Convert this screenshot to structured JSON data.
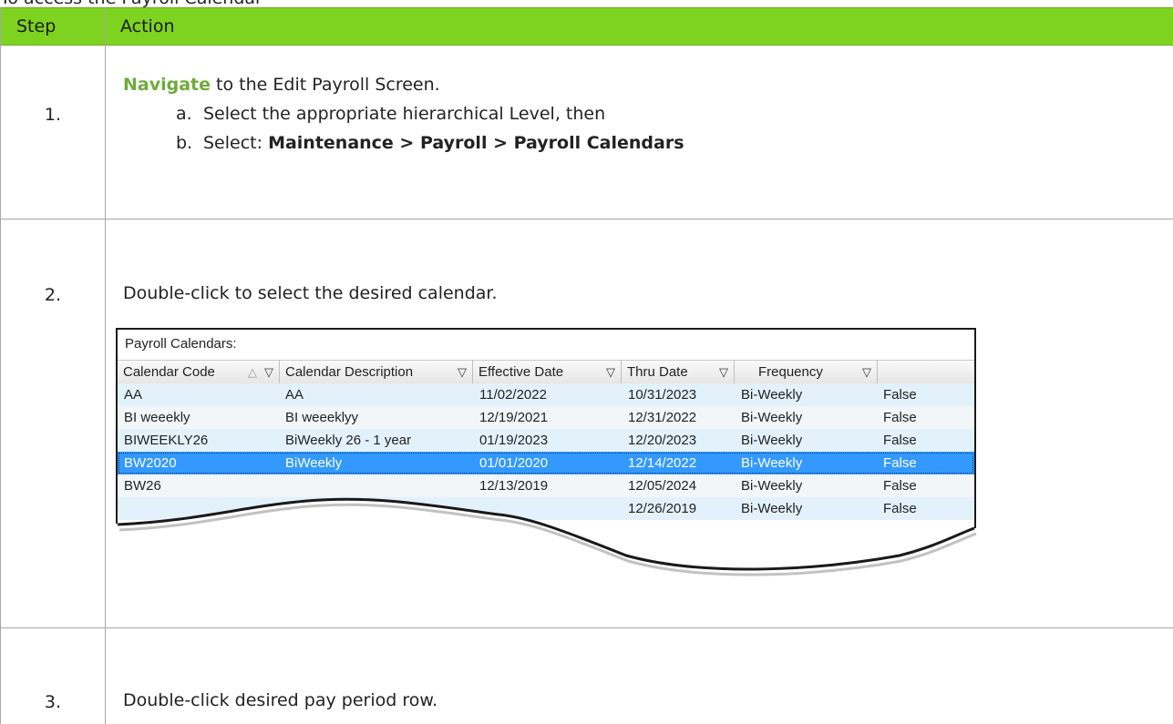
{
  "page": {
    "cut_heading": "To access the Payroll Calendar"
  },
  "table": {
    "header": {
      "step": "Step",
      "action": "Action"
    },
    "header_color": "#7ed321",
    "steps": [
      {
        "num": "1.",
        "nav_word": "Navigate",
        "text": " to the Edit Payroll Screen.",
        "subs": [
          {
            "letter": "a.",
            "text": "Select the appropriate hierarchical Level, then"
          },
          {
            "letter": "b.",
            "prefix": "Select: ",
            "bold": "Maintenance > Payroll > Payroll Calendars"
          }
        ]
      },
      {
        "num": "2.",
        "text": "Double-click to select the desired calendar."
      },
      {
        "num": "3.",
        "text": "Double-click desired pay period row."
      }
    ]
  },
  "grid": {
    "title": "Payroll Calendars:",
    "columns": [
      "Calendar Code",
      "Calendar Description",
      "Effective Date",
      "Thru Date",
      "Frequency",
      ""
    ],
    "filter_icon": "filter-icon",
    "sort_icon": "sort-asc-icon",
    "rows": [
      {
        "code": "AA",
        "desc": "AA",
        "eff": "11/02/2022",
        "thru": "10/31/2023",
        "freq": "Bi-Weekly",
        "flag": "False"
      },
      {
        "code": "BI weeekly",
        "desc": "BI weeeklyy",
        "eff": "12/19/2021",
        "thru": "12/31/2022",
        "freq": "Bi-Weekly",
        "flag": "False"
      },
      {
        "code": "BIWEEKLY26",
        "desc": "BiWeekly 26 - 1 year",
        "eff": "01/19/2023",
        "thru": "12/20/2023",
        "freq": "Bi-Weekly",
        "flag": "False"
      },
      {
        "code": "BW2020",
        "desc": "BiWeekly",
        "eff": "01/01/2020",
        "thru": "12/14/2022",
        "freq": "Bi-Weekly",
        "flag": "False"
      },
      {
        "code": "BW26",
        "desc": "",
        "eff": "12/13/2019",
        "thru": "12/05/2024",
        "freq": "Bi-Weekly",
        "flag": "False"
      },
      {
        "code": "",
        "desc": "",
        "eff": "",
        "thru": "12/26/2019",
        "freq": "Bi-Weekly",
        "flag": "False"
      }
    ],
    "selected_row": 3,
    "selected_color": "#3399ff"
  }
}
